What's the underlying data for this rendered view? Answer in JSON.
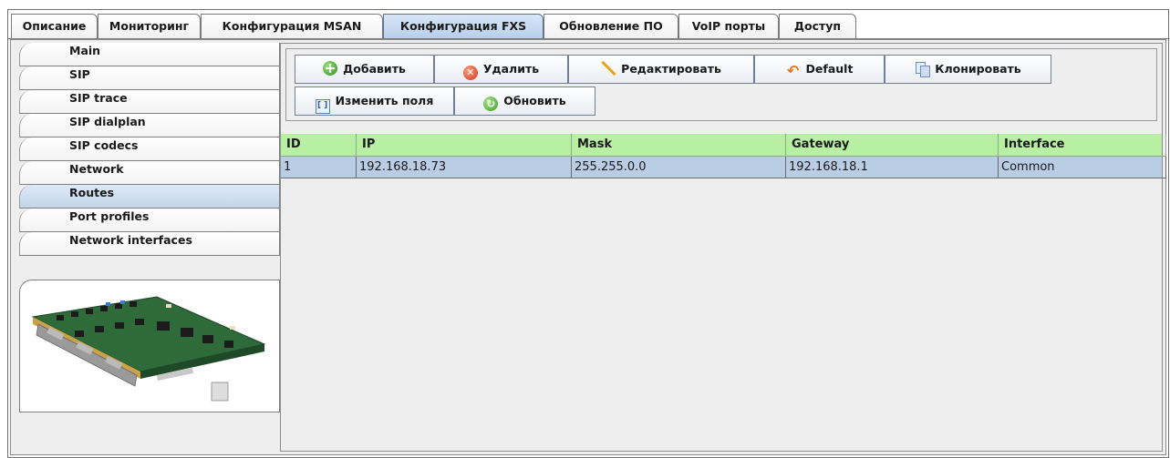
{
  "tabs": [
    {
      "label": "Описание"
    },
    {
      "label": "Мониторинг"
    },
    {
      "label": "Конфигурация MSAN"
    },
    {
      "label": "Конфигурация FXS",
      "active": true
    },
    {
      "label": "Обновление ПО"
    },
    {
      "label": "VoIP порты"
    },
    {
      "label": "Доступ"
    }
  ],
  "sidebar": {
    "items": [
      {
        "label": "Main"
      },
      {
        "label": "SIP"
      },
      {
        "label": "SIP trace"
      },
      {
        "label": "SIP dialplan"
      },
      {
        "label": "SIP codecs"
      },
      {
        "label": "Network"
      },
      {
        "label": "Routes",
        "active": true
      },
      {
        "label": "Port profiles"
      },
      {
        "label": "Network interfaces"
      }
    ]
  },
  "toolbar": {
    "add_label": "Добавить",
    "delete_label": "Удалить",
    "edit_label": "Редактировать",
    "default_label": "Default",
    "clone_label": "Клонировать",
    "change_fields_label": "Изменить поля",
    "refresh_label": "Обновить"
  },
  "table": {
    "columns": [
      "ID",
      "IP",
      "Mask",
      "Gateway",
      "Interface"
    ],
    "rows": [
      [
        "1",
        "192.168.18.73",
        "255.255.0.0",
        "192.168.18.1",
        "Common"
      ]
    ]
  },
  "colors": {
    "header_bg": "#b7f0a3",
    "selected_row": "#b9cde5",
    "active_tab": "#c4d6ec"
  }
}
